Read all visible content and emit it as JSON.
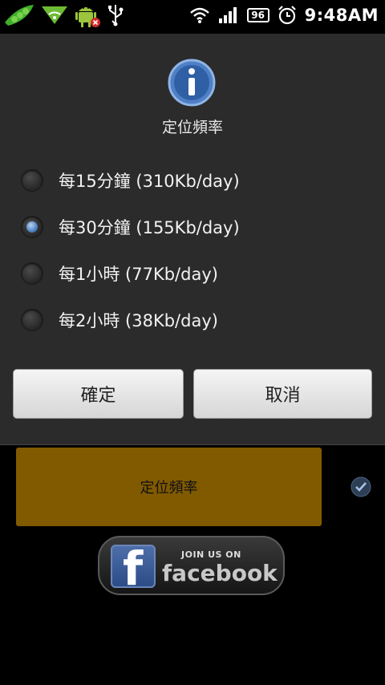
{
  "status_bar": {
    "battery": "96",
    "time": "9:48AM",
    "icons": [
      "peas-icon",
      "wifi-notification-icon",
      "android-icon",
      "usb-icon",
      "wifi-icon",
      "signal-icon",
      "battery-icon",
      "alarm-icon"
    ]
  },
  "dialog": {
    "icon": "info-icon",
    "title": "定位頻率",
    "options": [
      {
        "label": "每15分鐘 (310Kb/day)",
        "checked": false
      },
      {
        "label": "每30分鐘 (155Kb/day)",
        "checked": true
      },
      {
        "label": "每1小時 (77Kb/day)",
        "checked": false
      },
      {
        "label": "每2小時 (38Kb/day)",
        "checked": false
      }
    ],
    "ok_label": "確定",
    "cancel_label": "取消"
  },
  "background": {
    "freq_button_label": "定位頻率",
    "facebook": {
      "join_text": "JOIN US ON",
      "brand": "facebook"
    }
  },
  "colors": {
    "dialog_bg": "#2b2b2b",
    "freq_box": "#815a00",
    "radio_selected": "#3c76b8"
  }
}
